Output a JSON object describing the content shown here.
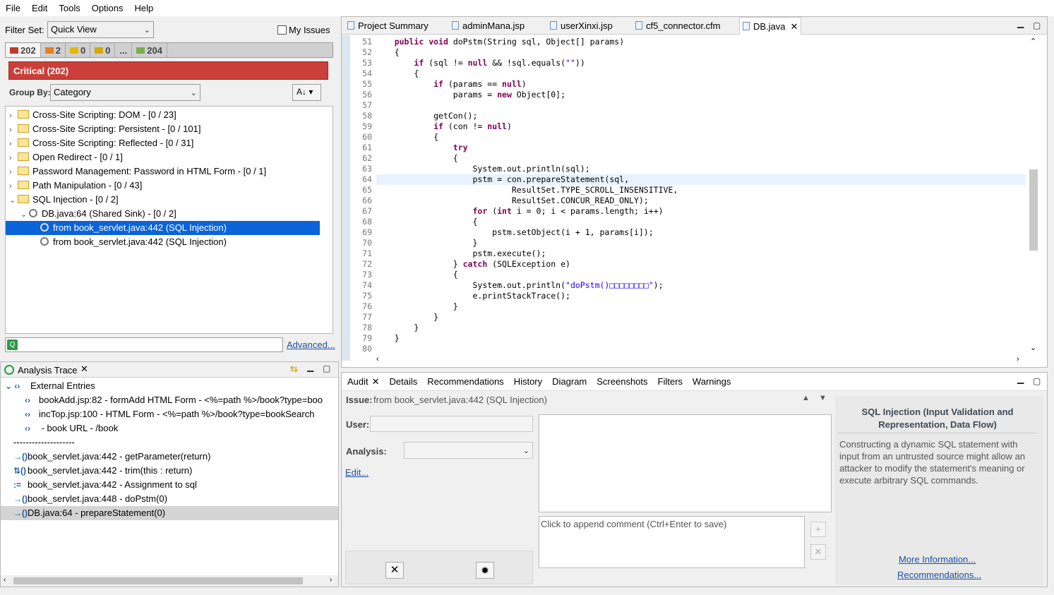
{
  "menu": [
    "File",
    "Edit",
    "Tools",
    "Options",
    "Help"
  ],
  "filter": {
    "label": "Filter Set:",
    "value": "Quick View",
    "my_issues": "My Issues"
  },
  "counts": [
    {
      "n": "202",
      "color": "#c0392b"
    },
    {
      "n": "2",
      "color": "#e67e22"
    },
    {
      "n": "0",
      "color": "#e8b800"
    },
    {
      "n": "0",
      "color": "#d4a900"
    },
    {
      "n": "...",
      "color": ""
    },
    {
      "n": "204",
      "color": "#7dab4e"
    }
  ],
  "critical": "Critical (202)",
  "group_by": {
    "label": "Group By:",
    "value": "Category"
  },
  "tree": [
    {
      "label": "Cross-Site Scripting: DOM - [0 / 23]",
      "lvl": 0,
      "tw": "›",
      "icon": "folder"
    },
    {
      "label": "Cross-Site Scripting: Persistent - [0 / 101]",
      "lvl": 0,
      "tw": "›",
      "icon": "folder"
    },
    {
      "label": "Cross-Site Scripting: Reflected - [0 / 31]",
      "lvl": 0,
      "tw": "›",
      "icon": "folder"
    },
    {
      "label": "Open Redirect - [0 / 1]",
      "lvl": 0,
      "tw": "›",
      "icon": "folder"
    },
    {
      "label": "Password Management: Password in HTML Form - [0 / 1]",
      "lvl": 0,
      "tw": "›",
      "icon": "folder"
    },
    {
      "label": "Path Manipulation - [0 / 43]",
      "lvl": 0,
      "tw": "›",
      "icon": "folder"
    },
    {
      "label": "SQL Injection - [0 / 2]",
      "lvl": 0,
      "tw": "⌄",
      "icon": "folder"
    },
    {
      "label": "DB.java:64 (Shared Sink) - [0 / 2]",
      "lvl": 1,
      "tw": "⌄",
      "icon": "issue"
    },
    {
      "label": "from book_servlet.java:442 (SQL Injection)",
      "lvl": 2,
      "tw": "",
      "icon": "issue",
      "sel": true
    },
    {
      "label": "from book_servlet.java:442 (SQL Injection)",
      "lvl": 2,
      "tw": "",
      "icon": "issue"
    }
  ],
  "advanced": "Advanced...",
  "trace": {
    "title": "Analysis Trace",
    "rows": [
      {
        "icon": "⌄ ‹›",
        "text": "External Entries",
        "indent": 0
      },
      {
        "icon": "‹›",
        "text": "bookAdd.jsp:82 - formAdd HTML Form - <%=path %>/book?type=boo",
        "indent": 1
      },
      {
        "icon": "‹›",
        "text": "incTop.jsp:100 - HTML Form - <%=path %>/book?type=bookSearch",
        "indent": 1
      },
      {
        "icon": "‹›",
        "text": " - book URL - /book",
        "indent": 1
      },
      {
        "icon": "",
        "text": "--------------------",
        "indent": 0
      },
      {
        "icon": "→()",
        "text": "book_servlet.java:442 - getParameter(return)",
        "indent": 0
      },
      {
        "icon": "⇅()",
        "text": "book_servlet.java:442 - trim(this : return)",
        "indent": 0
      },
      {
        "icon": ":=",
        "text": "book_servlet.java:442 - Assignment to sql",
        "indent": 0
      },
      {
        "icon": "→()",
        "text": "book_servlet.java:448 - doPstm(0)",
        "indent": 0
      },
      {
        "icon": "→()",
        "text": "DB.java:64 - prepareStatement(0)",
        "indent": 0,
        "sel": true
      }
    ]
  },
  "editor_tabs": [
    {
      "label": "Project Summary"
    },
    {
      "label": "adminMana.jsp"
    },
    {
      "label": "userXinxi.jsp"
    },
    {
      "label": "cf5_connector.cfm"
    },
    {
      "label": "DB.java",
      "active": true
    }
  ],
  "code": [
    {
      "n": "51",
      "t": "    <k>public</k> <k>void</k> doPstm(String sql, Object[] params)"
    },
    {
      "n": "52",
      "t": "    {"
    },
    {
      "n": "53",
      "t": "        <k>if</k> (sql != <k>null</k> && !sql.equals(<s>\"\"</s>))"
    },
    {
      "n": "54",
      "t": "        {"
    },
    {
      "n": "55",
      "t": "            <k>if</k> (params == <k>null</k>)"
    },
    {
      "n": "56",
      "t": "                params = <k>new</k> Object[0];"
    },
    {
      "n": "57",
      "t": ""
    },
    {
      "n": "58",
      "t": "            getCon();"
    },
    {
      "n": "59",
      "t": "            <k>if</k> (con != <k>null</k>)"
    },
    {
      "n": "60",
      "t": "            {"
    },
    {
      "n": "61",
      "t": "                <k>try</k>"
    },
    {
      "n": "62",
      "t": "                {"
    },
    {
      "n": "63",
      "t": "                    System.out.println(sql);"
    },
    {
      "n": "64",
      "t": "                    pstm = con.prepareStatement(sql,",
      "hl": true
    },
    {
      "n": "65",
      "t": "                            ResultSet.TYPE_SCROLL_INSENSITIVE,"
    },
    {
      "n": "66",
      "t": "                            ResultSet.CONCUR_READ_ONLY);"
    },
    {
      "n": "67",
      "t": "                    <k>for</k> (<k>int</k> i = 0; i < params.length; i++)"
    },
    {
      "n": "68",
      "t": "                    {"
    },
    {
      "n": "69",
      "t": "                        pstm.setObject(i + 1, params[i]);"
    },
    {
      "n": "70",
      "t": "                    }"
    },
    {
      "n": "71",
      "t": "                    pstm.execute();"
    },
    {
      "n": "72",
      "t": "                } <k>catch</k> (SQLException e)"
    },
    {
      "n": "73",
      "t": "                {"
    },
    {
      "n": "74",
      "t": "                    System.out.println(<s>\"doPstm()□□□□□□□□\"</s>);"
    },
    {
      "n": "75",
      "t": "                    e.printStackTrace();"
    },
    {
      "n": "76",
      "t": "                }"
    },
    {
      "n": "77",
      "t": "            }"
    },
    {
      "n": "78",
      "t": "        }"
    },
    {
      "n": "79",
      "t": "    }"
    },
    {
      "n": "80",
      "t": ""
    }
  ],
  "bottom_tabs": [
    "Audit",
    "Details",
    "Recommendations",
    "History",
    "Diagram",
    "Screenshots",
    "Filters",
    "Warnings"
  ],
  "audit": {
    "issue_label": "Issue:",
    "issue_value": "from book_servlet.java:442 (SQL Injection)",
    "user_label": "User:",
    "analysis_label": "Analysis:",
    "edit": "Edit...",
    "comment_placeholder": "Click to append comment (Ctrl+Enter to save)"
  },
  "info": {
    "title": "SQL Injection (Input Validation and Representation, Data Flow)",
    "body": "Constructing a dynamic SQL statement with input from an untrusted source might allow an attacker to modify the statement's meaning or execute arbitrary SQL commands.",
    "more": "More Information...",
    "recs": "Recommendations..."
  }
}
